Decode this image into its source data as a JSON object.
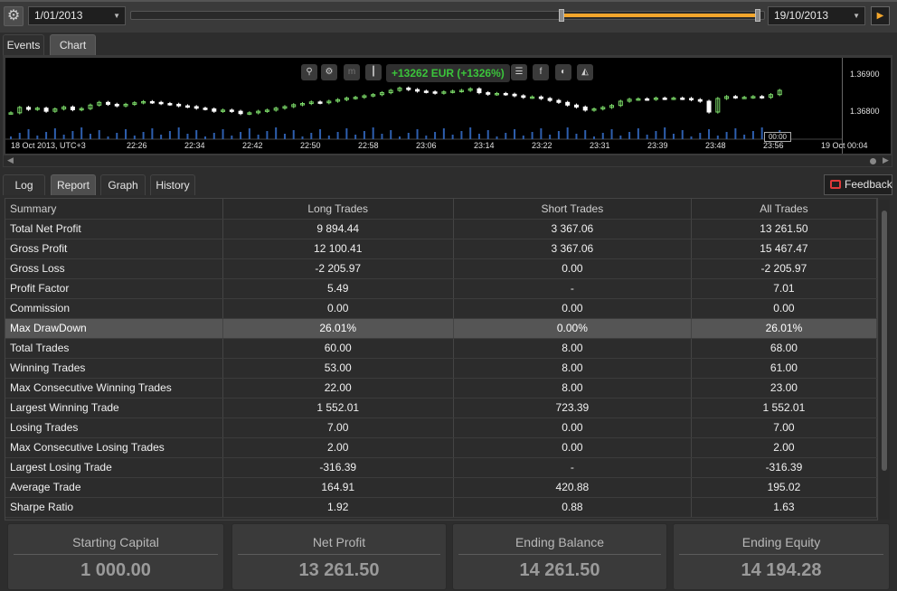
{
  "toolbar": {
    "start_date": "1/01/2013",
    "end_date": "19/10/2013",
    "range_start_fraction": 0.68,
    "range_end_fraction": 0.99
  },
  "chart_tabs": [
    "Events",
    "Chart"
  ],
  "chart": {
    "pnl_text": "+13262 EUR (+1326%)",
    "price_labels": [
      "1.36900",
      "1.36800"
    ],
    "time_labels": [
      "18 Oct 2013, UTC+3",
      "22:26",
      "22:34",
      "22:42",
      "22:50",
      "22:58",
      "23:06",
      "23:14",
      "23:22",
      "23:31",
      "23:39",
      "23:48",
      "23:56",
      "19 Oct 00:04"
    ],
    "cursor_label": "00:00",
    "up_color": "#7ddc6a",
    "down_color": "#ffffff",
    "icons": [
      "zoom-icon",
      "chart-settings-icon",
      "m-icon",
      "candles-icon",
      "list-icon",
      "facebook-icon",
      "share-icon",
      "layers-icon"
    ]
  },
  "chart_data": {
    "type": "candlestick",
    "y_range": [
      1.3674,
      1.3695
    ],
    "closes": [
      1.36808,
      1.36822,
      1.36817,
      1.3682,
      1.36812,
      1.36818,
      1.36823,
      1.36816,
      1.36819,
      1.36828,
      1.36835,
      1.3683,
      1.36826,
      1.3683,
      1.36834,
      1.36837,
      1.36835,
      1.36832,
      1.3683,
      1.36826,
      1.36824,
      1.3682,
      1.36818,
      1.36812,
      1.36815,
      1.36812,
      1.36806,
      1.36808,
      1.36812,
      1.36815,
      1.3682,
      1.36824,
      1.36829,
      1.36832,
      1.36836,
      1.36834,
      1.36838,
      1.36842,
      1.36846,
      1.36848,
      1.36852,
      1.36855,
      1.3686,
      1.36866,
      1.36872,
      1.36868,
      1.36864,
      1.36862,
      1.36859,
      1.36862,
      1.36864,
      1.36866,
      1.3687,
      1.3686,
      1.36856,
      1.36858,
      1.36856,
      1.36852,
      1.36848,
      1.36849,
      1.36845,
      1.3684,
      1.36835,
      1.36828,
      1.36823,
      1.36815,
      1.36818,
      1.36822,
      1.36827,
      1.36838,
      1.36843,
      1.36844,
      1.36843,
      1.36846,
      1.36845,
      1.36846,
      1.36845,
      1.36842,
      1.36838,
      1.3681,
      1.36845,
      1.3685,
      1.36848,
      1.36848,
      1.3685,
      1.36848,
      1.36855,
      1.36866
    ]
  },
  "report_tabs": [
    "Log",
    "Report",
    "Graph",
    "History"
  ],
  "feedback_label": "Feedback",
  "report": {
    "headers": [
      "Summary",
      "Long Trades",
      "Short Trades",
      "All Trades"
    ],
    "rows": [
      [
        "Total Net Profit",
        "9 894.44",
        "3 367.06",
        "13 261.50"
      ],
      [
        "Gross Profit",
        "12 100.41",
        "3 367.06",
        "15 467.47"
      ],
      [
        "Gross Loss",
        "-2 205.97",
        "0.00",
        "-2 205.97"
      ],
      [
        "Profit Factor",
        "5.49",
        "-",
        "7.01"
      ],
      [
        "Commission",
        "0.00",
        "0.00",
        "0.00"
      ],
      [
        "Max DrawDown",
        "26.01%",
        "0.00%",
        "26.01%"
      ],
      [
        "Total Trades",
        "60.00",
        "8.00",
        "68.00"
      ],
      [
        "Winning Trades",
        "53.00",
        "8.00",
        "61.00"
      ],
      [
        "Max Consecutive Winning Trades",
        "22.00",
        "8.00",
        "23.00"
      ],
      [
        "Largest Winning Trade",
        "1 552.01",
        "723.39",
        "1 552.01"
      ],
      [
        "Losing Trades",
        "7.00",
        "0.00",
        "7.00"
      ],
      [
        "Max Consecutive Losing Trades",
        "2.00",
        "0.00",
        "2.00"
      ],
      [
        "Largest Losing Trade",
        "-316.39",
        "-",
        "-316.39"
      ],
      [
        "Average Trade",
        "164.91",
        "420.88",
        "195.02"
      ],
      [
        "Sharpe Ratio",
        "1.92",
        "0.88",
        "1.63"
      ]
    ]
  },
  "cards": [
    {
      "title": "Starting Capital",
      "value": "1 000.00"
    },
    {
      "title": "Net Profit",
      "value": "13 261.50"
    },
    {
      "title": "Ending Balance",
      "value": "14 261.50"
    },
    {
      "title": "Ending Equity",
      "value": "14 194.28"
    }
  ]
}
